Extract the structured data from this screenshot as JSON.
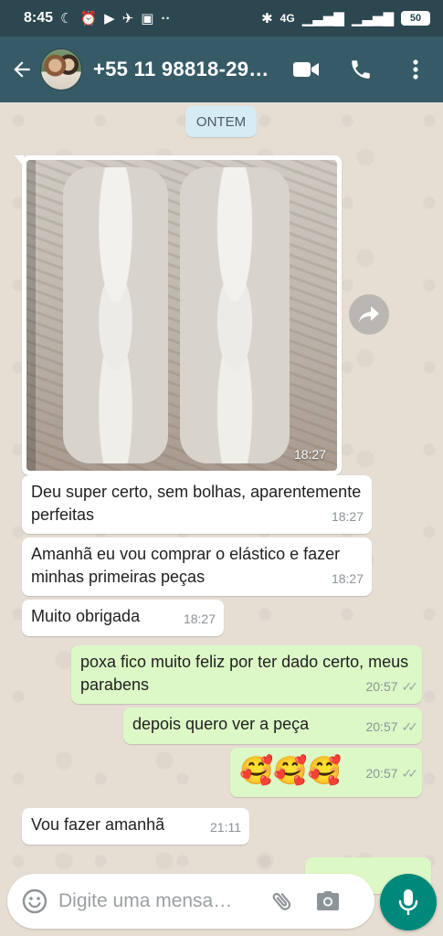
{
  "status_bar": {
    "time": "8:45",
    "network_label": "4G",
    "battery": "50"
  },
  "header": {
    "contact": "+55 11 98818-29…"
  },
  "chat": {
    "date_chip": "ONTEM",
    "image_time": "18:27",
    "messages": [
      {
        "text": "Deu super certo, sem bolhas, aparentemente perfeitas",
        "time": "18:27",
        "direction": "incoming"
      },
      {
        "text": "Amanhã eu vou comprar o elástico e fazer minhas primeiras peças",
        "time": "18:27",
        "direction": "incoming"
      },
      {
        "text": "Muito obrigada",
        "time": "18:27",
        "direction": "incoming"
      },
      {
        "text": "poxa fico muito feliz por ter dado certo, meus parabens",
        "time": "20:57",
        "direction": "outgoing"
      },
      {
        "text": "depois quero ver a peça",
        "time": "20:57",
        "direction": "outgoing"
      },
      {
        "text": "🥰🥰🥰",
        "time": "20:57",
        "direction": "outgoing"
      },
      {
        "text": "Vou fazer amanhã",
        "time": "21:11",
        "direction": "incoming"
      }
    ]
  },
  "composer": {
    "placeholder": "Digite uma mensa…"
  },
  "colors": {
    "header": "#365b66",
    "status_bar": "#2c4750",
    "outgoing_bubble": "#dcf8c6",
    "mic_button": "#00897b"
  }
}
